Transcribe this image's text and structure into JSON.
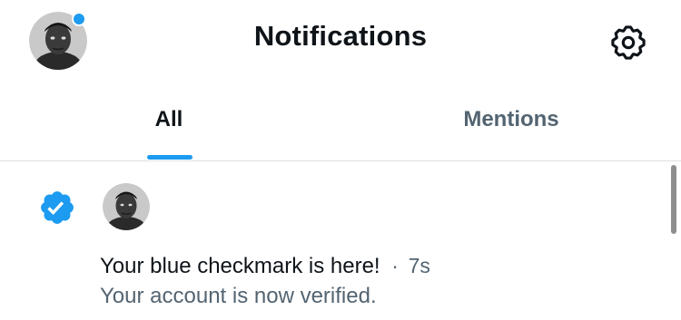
{
  "header": {
    "title": "Notifications",
    "avatar_icon": "user-avatar",
    "settings_icon": "gear-icon",
    "unread_dot_color": "#1d9bf0"
  },
  "tabs": [
    {
      "label": "All",
      "active": true
    },
    {
      "label": "Mentions",
      "active": false
    }
  ],
  "accent_color": "#1d9bf0",
  "notifications": [
    {
      "icon": "verified-badge-icon",
      "title": "Your blue checkmark is here!",
      "separator": "·",
      "time": "7s",
      "subtitle": "Your account is now verified."
    }
  ]
}
